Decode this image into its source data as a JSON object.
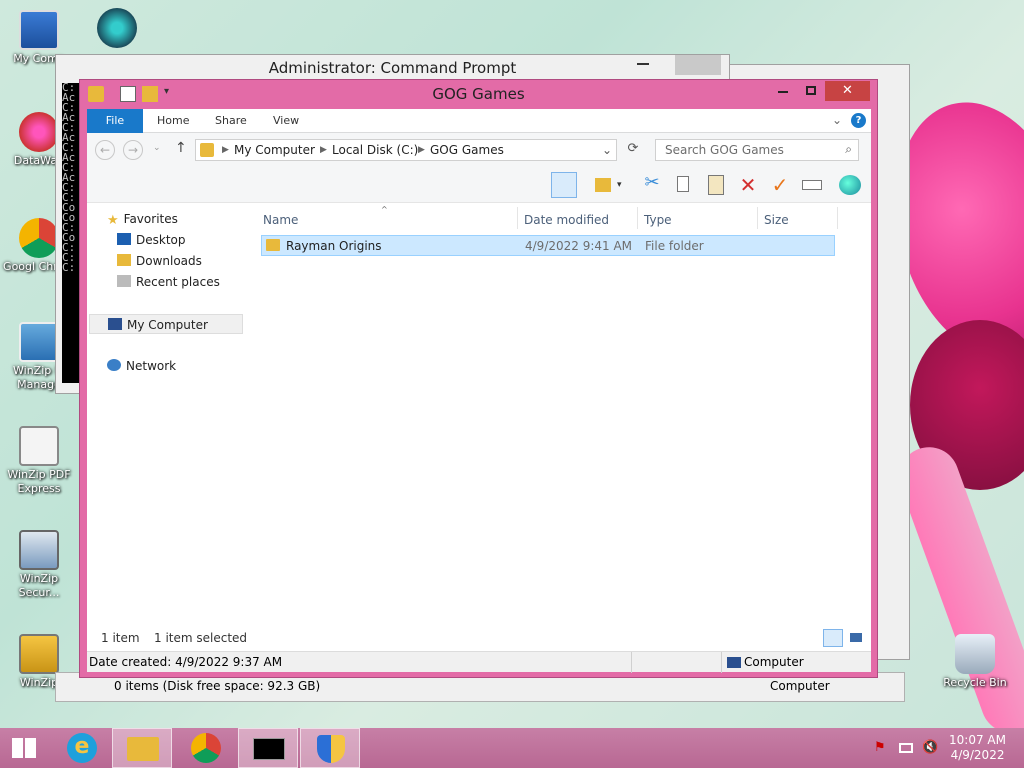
{
  "desktop": {
    "icons": [
      {
        "label": "My Comp"
      },
      {
        "label": ""
      },
      {
        "label": "DataWag"
      },
      {
        "label": "Googl Chrom"
      },
      {
        "label": "WinZip In Manage"
      },
      {
        "label": "WinZip PDF Express"
      },
      {
        "label": "WinZip Secur..."
      },
      {
        "label": "WinZip"
      },
      {
        "label": "Recycle Bin"
      }
    ]
  },
  "cmd_window": {
    "title": "Administrator: Command Prompt",
    "lines": "C: Ac C: Ac C: Ac C: Ac C: Ac C: C: Co Co C: Co C: C: C:"
  },
  "explorer": {
    "title": "GOG Games",
    "tabs": [
      "File",
      "Home",
      "Share",
      "View"
    ],
    "breadcrumb": [
      "My Computer",
      "Local Disk (C:)",
      "GOG Games"
    ],
    "search_placeholder": "Search GOG Games",
    "nav": {
      "favorites": "Favorites",
      "desktop": "Desktop",
      "downloads": "Downloads",
      "recent": "Recent places",
      "my_computer": "My Computer",
      "network": "Network"
    },
    "columns": [
      "Name",
      "Date modified",
      "Type",
      "Size"
    ],
    "rows": [
      {
        "name": "Rayman Origins",
        "date": "4/9/2022 9:41 AM",
        "type": "File folder",
        "size": ""
      }
    ],
    "status": {
      "count": "1 item",
      "selected": "1 item selected"
    },
    "details": {
      "created": "Date created: 4/9/2022 9:37 AM",
      "location": "Computer"
    }
  },
  "back_status": {
    "free": "0 items (Disk free space: 92.3 GB)",
    "location": "Computer"
  },
  "taskbar": {
    "time": "10:07 AM",
    "date": "4/9/2022"
  },
  "colors": {
    "window_frame": "#e36ba7",
    "file_tab": "#1979ca",
    "selection": "#cce8ff",
    "taskbar": "#b86893"
  }
}
